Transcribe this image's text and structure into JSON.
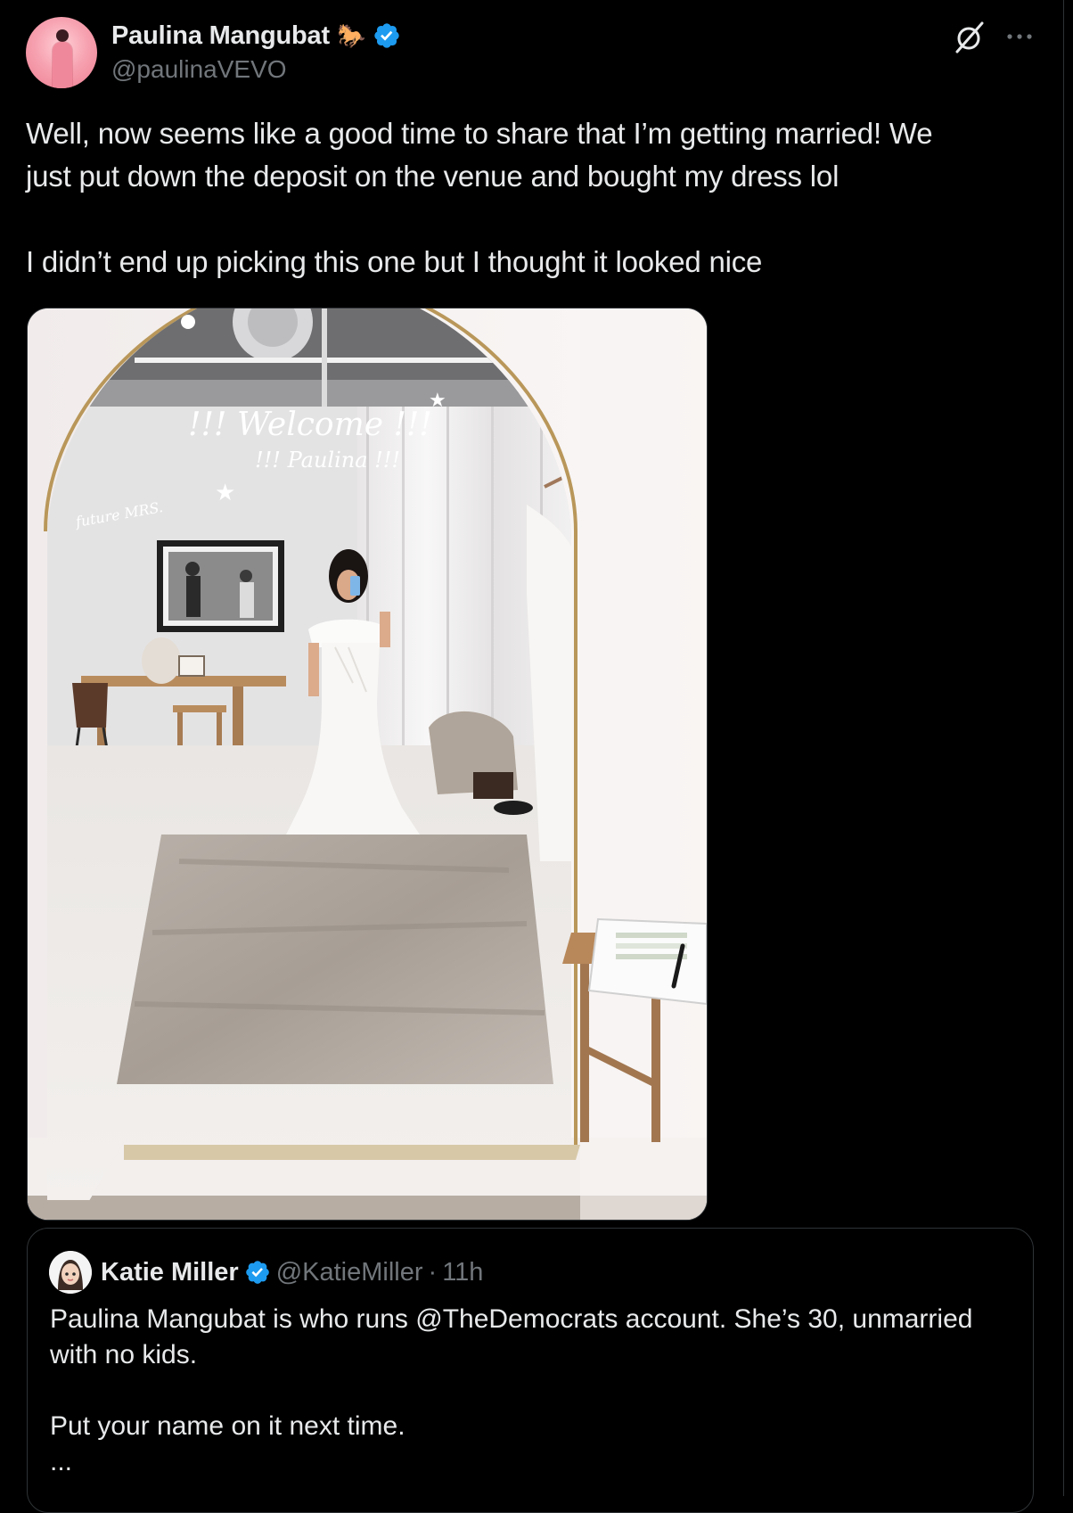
{
  "author": {
    "display_name": "Paulina Mangubat",
    "name_emoji": "🐎",
    "handle": "@paulinaVEVO",
    "verified": true
  },
  "icons": {
    "verified": "verified-badge-icon",
    "grok": "grok-icon",
    "more": "more-icon",
    "horse": "horse-emoji-icon"
  },
  "tweet": {
    "lines": [
      "Well, now seems like a good time to share that I’m getting married! We",
      "just put down the deposit on the venue and bought my dress lol"
    ],
    "paragraph2": "I didn’t end up picking this one but I thought it looked nice"
  },
  "photo": {
    "mirror_text_1": "!!! Welcome !!!",
    "mirror_text_2": "!!! Paulina !!!",
    "mirror_text_3": "future MRS."
  },
  "quote": {
    "display_name": "Katie Miller",
    "handle": "@KatieMiller",
    "separator": "·",
    "time": "11h",
    "verified": true,
    "line1": "Paulina Mangubat is who runs @TheDemocrats account. She’s 30, unmarried",
    "line2": "with no kids.",
    "line3": "Put your name on it next time.",
    "ellipsis": "..."
  },
  "colors": {
    "background": "#000000",
    "text_primary": "#e7e9ea",
    "text_secondary": "#71767b",
    "border": "#2f3336",
    "verified_blue": "#1d9bf0"
  }
}
